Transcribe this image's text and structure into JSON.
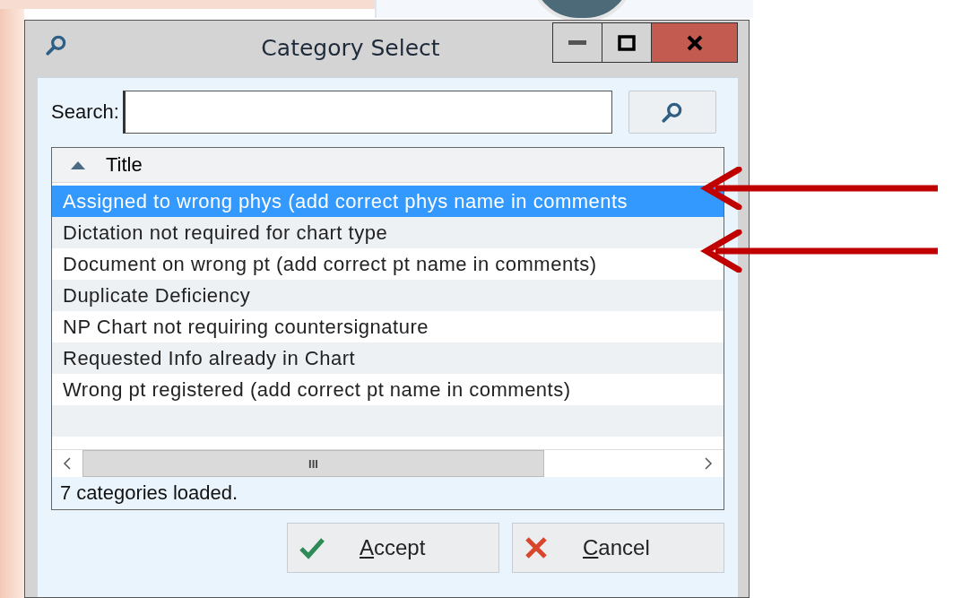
{
  "window": {
    "title": "Category Select"
  },
  "search": {
    "label": "Search:"
  },
  "table": {
    "columns": [
      {
        "title": "Title",
        "sort_ascending": true
      }
    ],
    "rows": [
      {
        "title": "Assigned to wrong phys (add correct phys name in comments",
        "selected": true,
        "arrow": true
      },
      {
        "title": "Dictation not required for chart type",
        "selected": false,
        "arrow": false
      },
      {
        "title": "Document on wrong pt (add correct pt name in comments)",
        "selected": false,
        "arrow": true
      },
      {
        "title": "Duplicate Deficiency",
        "selected": false,
        "arrow": false
      },
      {
        "title": "NP Chart not requiring countersignature",
        "selected": false,
        "arrow": false
      },
      {
        "title": "Requested Info already in Chart",
        "selected": false,
        "arrow": false
      },
      {
        "title": "Wrong pt registered (add correct pt name in comments)",
        "selected": false,
        "arrow": false
      }
    ]
  },
  "scrollbar_thumb": "III",
  "status": "7 categories loaded.",
  "buttons": [
    {
      "label": "Accept",
      "kind": "accept"
    },
    {
      "label": "Cancel",
      "kind": "cancel"
    }
  ]
}
